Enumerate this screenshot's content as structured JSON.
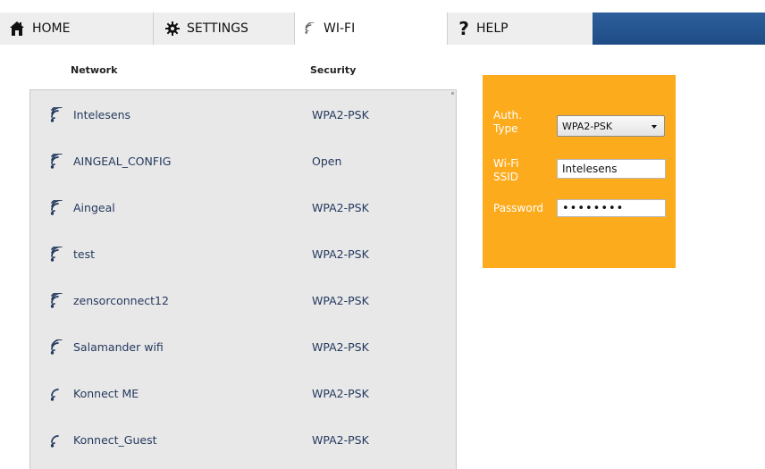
{
  "tabs": {
    "home": "HOME",
    "settings": "SETTINGS",
    "wifi": "WI-FI",
    "help_glyph": "?",
    "help": "HELP"
  },
  "columns": {
    "network": "Network",
    "security": "Security"
  },
  "networks": [
    {
      "name": "Intelesens",
      "security": "WPA2-PSK",
      "signal": "full"
    },
    {
      "name": "AINGEAL_CONFIG",
      "security": "Open",
      "signal": "full"
    },
    {
      "name": "Aingeal",
      "security": "WPA2-PSK",
      "signal": "full"
    },
    {
      "name": "test",
      "security": "WPA2-PSK",
      "signal": "full"
    },
    {
      "name": "zensorconnect12",
      "security": "WPA2-PSK",
      "signal": "full"
    },
    {
      "name": "Salamander wifi",
      "security": "WPA2-PSK",
      "signal": "medium"
    },
    {
      "name": "Konnect ME",
      "security": "WPA2-PSK",
      "signal": "low"
    },
    {
      "name": "Konnect_Guest",
      "security": "WPA2-PSK",
      "signal": "low"
    }
  ],
  "panel": {
    "auth_label": "Auth. Type",
    "auth_value": "WPA2-PSK",
    "ssid_label": "Wi-Fi SSID",
    "ssid_value": "Intelesens",
    "password_label": "Password",
    "password_value": "password"
  },
  "colors": {
    "panel_bg": "#fcab1c",
    "list_bg": "#e8e8e8",
    "text_blue": "#24395e",
    "tab_bar_accent": "#2d5f9c"
  }
}
